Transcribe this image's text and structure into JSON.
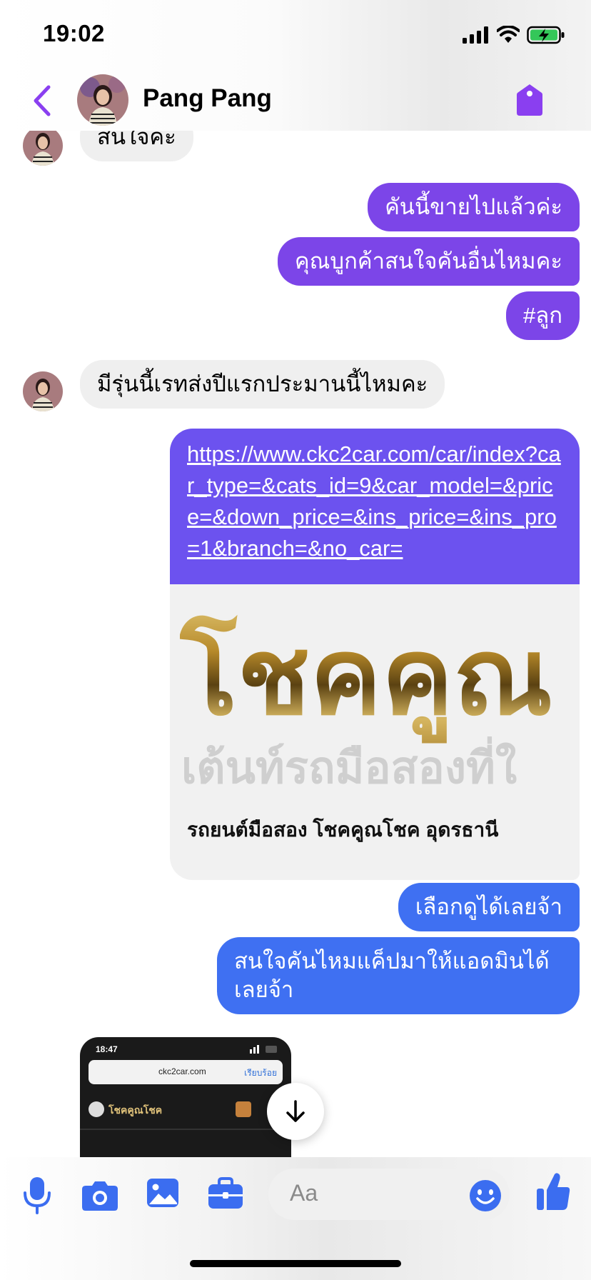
{
  "status_bar": {
    "time": "19:02",
    "battery_state": "charging"
  },
  "header": {
    "contact_name": "Pang Pang",
    "back_icon": "chevron-left-icon",
    "tag_icon": "tag-icon",
    "accent_color": "#8a3ff0"
  },
  "messages": {
    "m1": {
      "text": "สนใจค่ะ"
    },
    "m2": {
      "text": "คันนี้ขายไปแล้วค่ะ"
    },
    "m3": {
      "text": "คุณบูกค้าสนใจคันอื่นไหมคะ"
    },
    "m4": {
      "text": "#ลูก"
    },
    "m5": {
      "text": "มีรุ่นนี้เรทส่งปีแรกประมานนี้ไหมคะ"
    },
    "m6": {
      "url": "https://www.ckc2car.com/car/index?car_type=&cats_id=9&car_model=&price=&down_price=&ins_price=&ins_pro=1&branch=&no_car=",
      "preview_logo": "โชคคูณ",
      "preview_logo_sub": "เต้นท์รถมือสองที่ใ",
      "preview_title": "รถยนต์มือสอง โชคคูณโชค อุดรธานี"
    },
    "m7": {
      "text": "เลือกดูได้เลยจ้า"
    },
    "m8": {
      "text": "สนใจคันไหมแค็ปมาให้แอดมินได้เลยจ้า"
    },
    "m9": {
      "screenshot_time": "18:47",
      "screenshot_url": "ckc2car.com",
      "screenshot_done": "เรียบร้อย",
      "screenshot_logo": "โชคคูณโชค"
    }
  },
  "colors": {
    "outgoing_purple": "#7c45e8",
    "outgoing_link": "#6c52ef",
    "outgoing_blue": "#3f70f2",
    "incoming": "#efefef"
  },
  "composer": {
    "placeholder": "Aa",
    "icons": [
      "microphone-icon",
      "camera-icon",
      "photo-icon",
      "briefcase-icon",
      "emoji-icon",
      "thumbs-up-icon"
    ]
  }
}
